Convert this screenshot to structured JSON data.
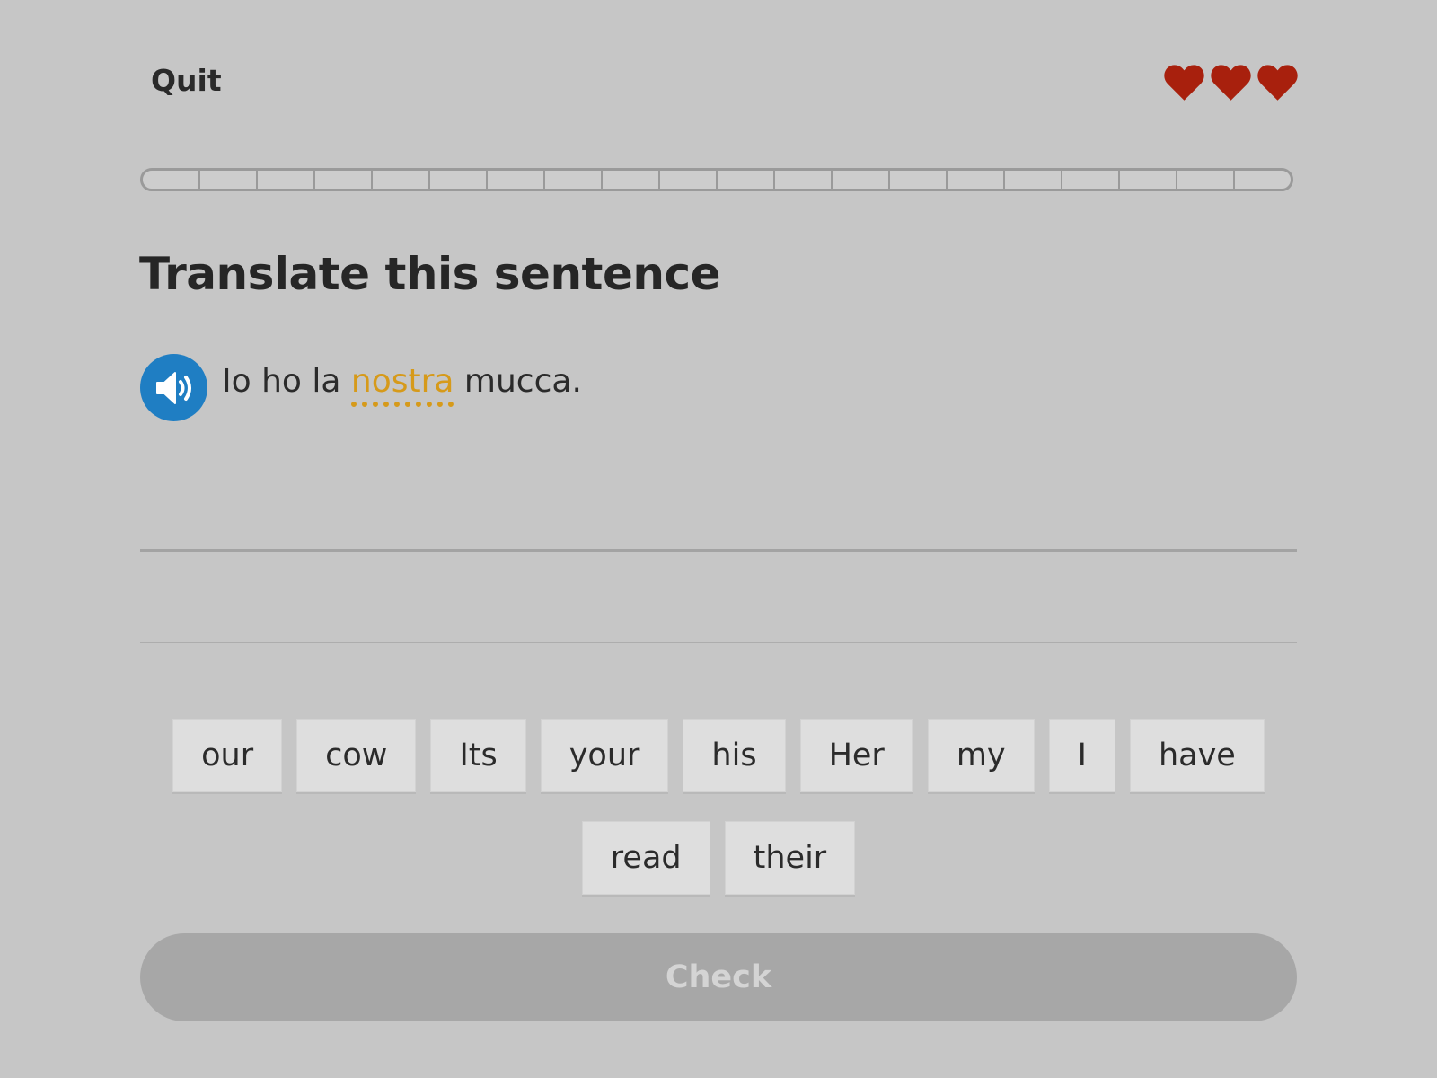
{
  "header": {
    "quit_label": "Quit",
    "hearts": 3,
    "heart_color": "#a8200d"
  },
  "progress": {
    "completed_fraction": 0,
    "segments": 20
  },
  "prompt": {
    "title": "Translate this sentence",
    "speaker_icon": "speaker-icon",
    "sentence_before": "Io ho la",
    "hint_word": "nostra",
    "sentence_after": "mucca."
  },
  "word_bank": {
    "row1": [
      "our",
      "cow",
      "Its",
      "your",
      "his",
      "Her",
      "my",
      "I",
      "have"
    ],
    "row2": [
      "read",
      "their"
    ]
  },
  "footer": {
    "check_label": "Check"
  },
  "colors": {
    "background": "#c6c6c6",
    "speaker_blue": "#1f7ec3",
    "hint_orange": "#d69a1a",
    "check_disabled": "#a7a7a7"
  }
}
